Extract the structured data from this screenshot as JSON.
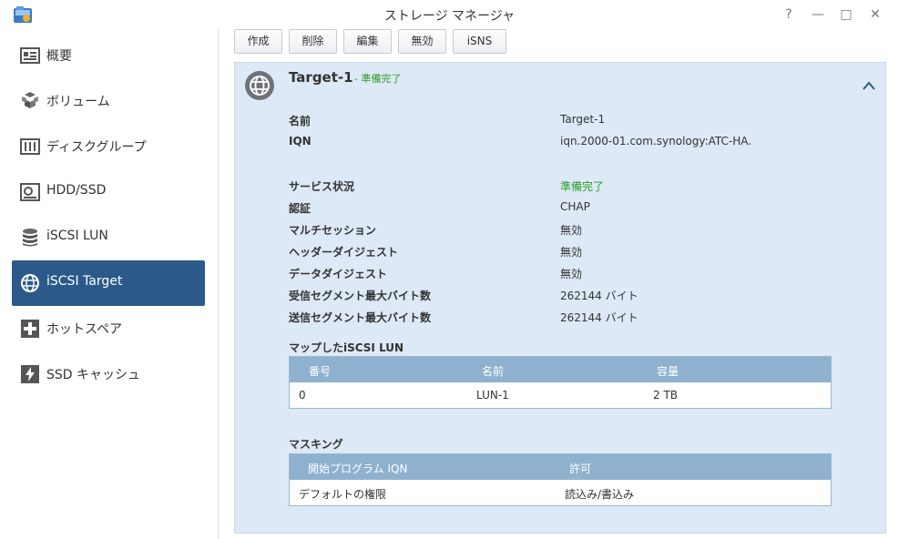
{
  "window": {
    "title": "ストレージ マネージャ",
    "help": "?",
    "minimize": "—",
    "maximize": "□",
    "close": "✕"
  },
  "sidebar": {
    "items": [
      {
        "label": "概要",
        "icon": "overview-icon",
        "active": false
      },
      {
        "label": "ボリューム",
        "icon": "volume-icon",
        "active": false
      },
      {
        "label": "ディスクグループ",
        "icon": "disk-group-icon",
        "active": false
      },
      {
        "label": "HDD/SSD",
        "icon": "hdd-icon",
        "active": false
      },
      {
        "label": "iSCSI LUN",
        "icon": "database-icon",
        "active": false
      },
      {
        "label": "iSCSI Target",
        "icon": "globe-icon",
        "active": true
      },
      {
        "label": "ホットスペア",
        "icon": "hot-spare-icon",
        "active": false
      },
      {
        "label": "SSD キャッシュ",
        "icon": "ssd-cache-icon",
        "active": false
      }
    ]
  },
  "toolbar": {
    "create": "作成",
    "delete": "削除",
    "edit": "編集",
    "disable": "無効",
    "isns": "iSNS"
  },
  "target": {
    "name": "Target-1",
    "status": "- 準備完了",
    "properties": [
      {
        "label": "名前",
        "value": "Target-1"
      },
      {
        "label": "IQN",
        "value": "iqn.2000-01.com.synology:ATC-HA."
      },
      {
        "label": "サービス状況",
        "value": "準備完了"
      },
      {
        "label": "認証",
        "value": "CHAP"
      },
      {
        "label": "マルチセッション",
        "value": "無効"
      },
      {
        "label": "ヘッダーダイジェスト",
        "value": "無効"
      },
      {
        "label": "データダイジェスト",
        "value": "無効"
      },
      {
        "label": "受信セグメント最大バイト数",
        "value": "262144 バイト"
      },
      {
        "label": "送信セグメント最大バイト数",
        "value": "262144 バイト"
      }
    ]
  },
  "lun_section": {
    "title": "マップしたiSCSI LUN",
    "columns": [
      "番号",
      "名前",
      "容量"
    ],
    "rows": [
      [
        "0",
        "LUN-1",
        "2 TB"
      ]
    ]
  },
  "masking_section": {
    "title": "マスキング",
    "columns": [
      "開始プログラム IQN",
      "許可"
    ],
    "rows": [
      [
        "デフォルトの権限",
        "読込み/書込み"
      ]
    ]
  },
  "colors": {
    "active_nav": "#2b5a8a",
    "panel_bg": "#dde9f6",
    "grid_header": "#8eb1cf",
    "status_green": "#2a9c28"
  }
}
